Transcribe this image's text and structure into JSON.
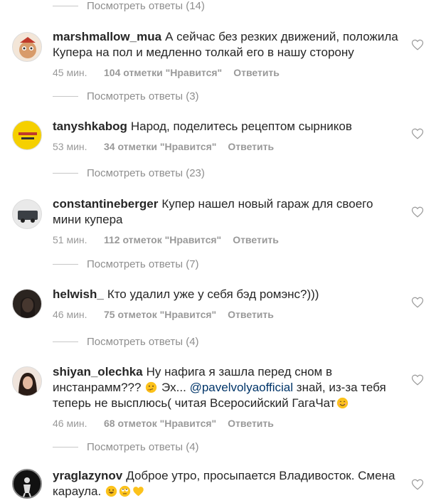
{
  "view_replies_label": "Посмотреть ответы",
  "comments": [
    {
      "username": "marshmallow_mua",
      "text": "А сейчас без резких движений, положила Купера на пол и медленно толкай его в нашу сторону",
      "time": "45 мин.",
      "likes": "104 отметки \"Нравится\"",
      "reply": "Ответить",
      "replies_count": "(3)"
    },
    {
      "username": "tanyshkabog",
      "text": "Народ, поделитесь рецептом сырников",
      "time": "53 мин.",
      "likes": "34 отметки \"Нравится\"",
      "reply": "Ответить",
      "replies_count": "(23)"
    },
    {
      "username": "constantineberger",
      "text": "Купер нашел новый гараж для своего мини купера",
      "time": "51 мин.",
      "likes": "112 отметок \"Нравится\"",
      "reply": "Ответить",
      "replies_count": "(7)"
    },
    {
      "username": "helwish_",
      "text": "Кто удалил уже у себя бэд ромэнс?)))",
      "time": "46 мин.",
      "likes": "75 отметок \"Нравится\"",
      "reply": "Ответить",
      "replies_count": "(4)"
    },
    {
      "username": "shiyan_olechka",
      "text_a": "Ну нафига я зашла перед сном в инстанрамм???",
      "text_b": "Эх...",
      "mention": "@pavelvolyaofficial",
      "text_c": "знай, из-за тебя теперь не высплюсь( читая Всеросийский ГагаЧат",
      "time": "46 мин.",
      "likes": "68 отметок \"Нравится\"",
      "reply": "Ответить",
      "replies_count": "(4)"
    },
    {
      "username": "yraglazynov",
      "text": "Доброе утро, просыпается Владивосток. Смена караула."
    }
  ],
  "top_replies_count": "(14)",
  "icons": {
    "like": "heart-outline-icon",
    "emoji": [
      "thinking-face-emoji",
      "smiling-face-emoji",
      "grinning-face-emoji",
      "rolling-eyes-emoji",
      "yellow-heart-emoji"
    ]
  }
}
